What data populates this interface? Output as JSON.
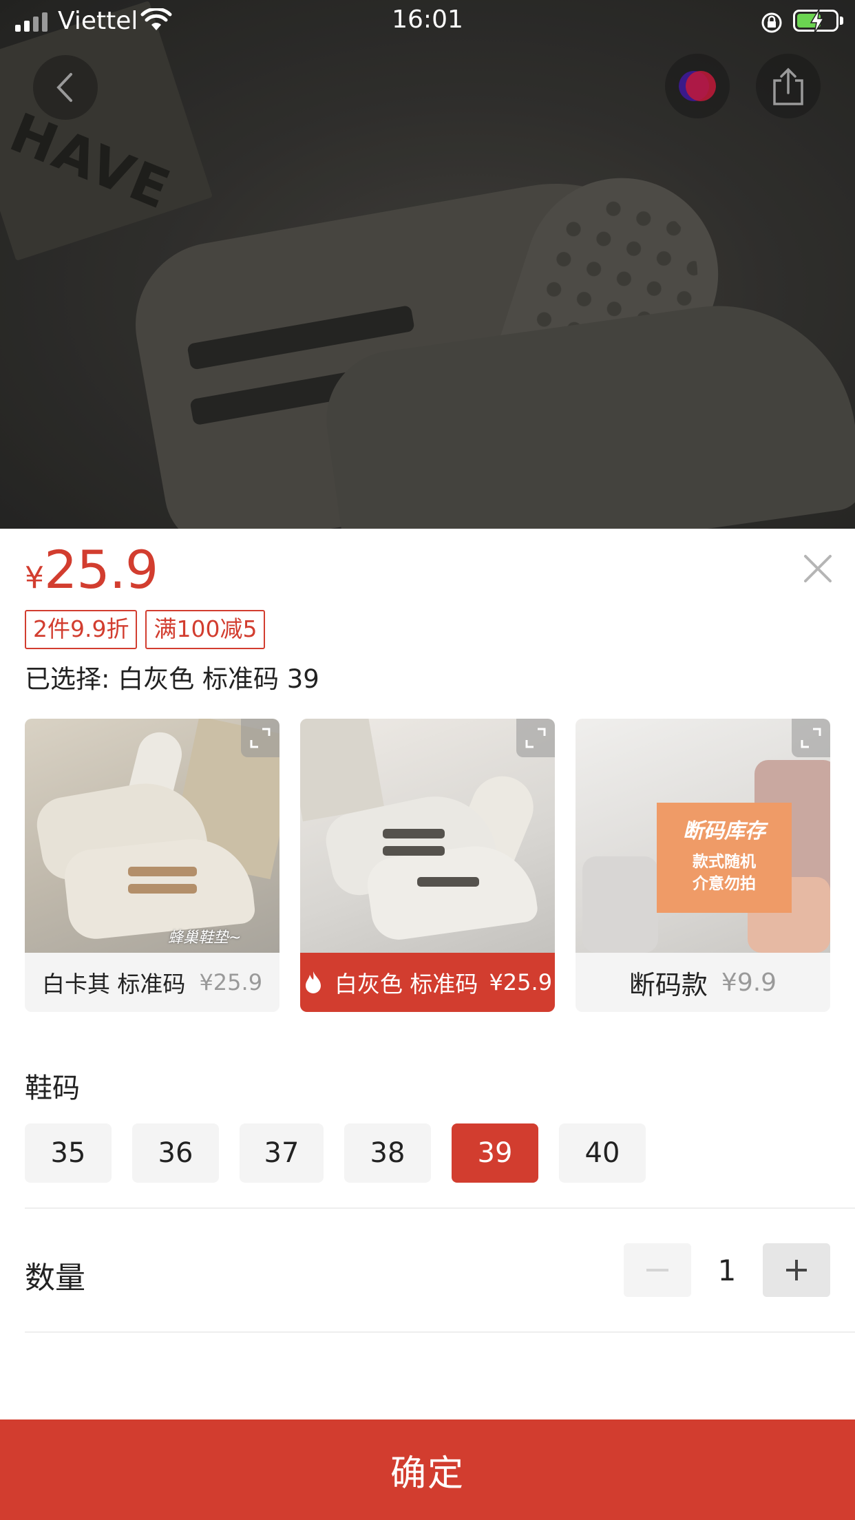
{
  "status_bar": {
    "carrier": "Viettel",
    "time": "16:01",
    "battery_charging": true,
    "icons": [
      "signal-icon",
      "wifi-icon",
      "orientation-lock-icon",
      "battery-charging-icon"
    ]
  },
  "hero": {
    "photo_text": "HAVE",
    "buttons": [
      "back-icon",
      "screenshot-capture-icon",
      "share-icon"
    ]
  },
  "sheet": {
    "price_currency": "¥",
    "price_value": "25.9",
    "promos": [
      "2件9.9折",
      "满100减5"
    ],
    "selected_text": "已选择: 白灰色 标准码 39",
    "variants": [
      {
        "label": "白卡其 标准码",
        "price": "¥25.9",
        "selected": false,
        "sticker": "蜂巢鞋垫~"
      },
      {
        "label": "白灰色 标准码",
        "price": "¥25.9",
        "selected": true,
        "hot": true
      },
      {
        "label": "断码款",
        "price": "¥9.9",
        "selected": false,
        "promo_title": "断码库存",
        "promo_line1": "款式随机",
        "promo_line2": "介意勿拍"
      }
    ],
    "size_title": "鞋码",
    "sizes": [
      "35",
      "36",
      "37",
      "38",
      "39",
      "40"
    ],
    "selected_size": "39",
    "quantity_label": "数量",
    "quantity": "1",
    "confirm_label": "确定"
  },
  "colors": {
    "accent": "#d23d2f",
    "chip_bg": "#f4f4f4",
    "battery_green": "#6bd451"
  }
}
